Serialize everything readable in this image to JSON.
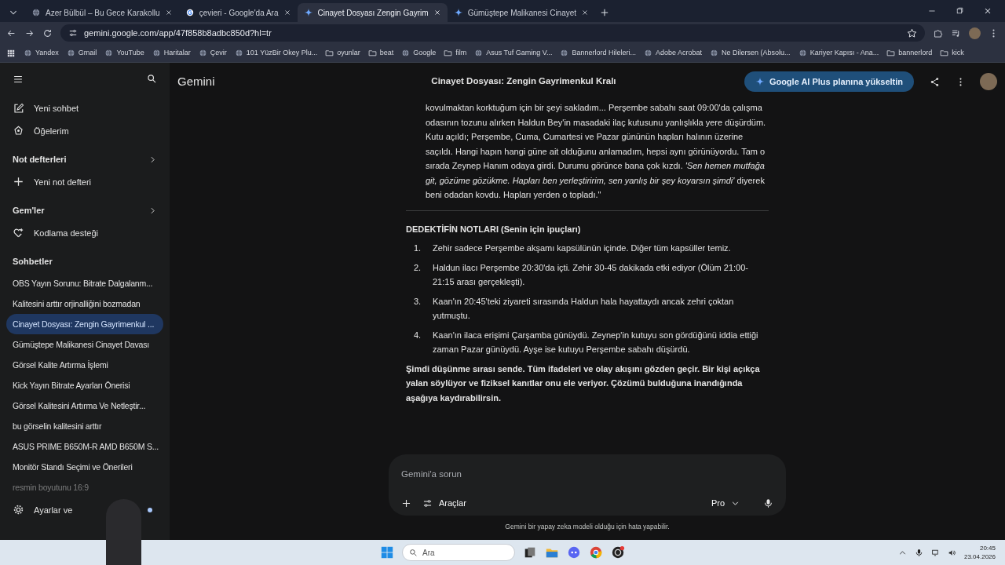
{
  "browser": {
    "tabs": [
      {
        "title": "Azer Bülbül – Bu Gece Karakollu",
        "selected": false
      },
      {
        "title": "çevieri - Google'da Ara",
        "selected": false
      },
      {
        "title": "Cinayet Dosyası Zengin Gayrim",
        "selected": true
      },
      {
        "title": "Gümüştepe Malikanesi Cinayet",
        "selected": false
      }
    ],
    "address": "gemini.google.com/app/47f858b8adbc850d?hl=tr",
    "bookmarks": [
      {
        "label": "Yandex",
        "kind": "site"
      },
      {
        "label": "Gmail",
        "kind": "site"
      },
      {
        "label": "YouTube",
        "kind": "site"
      },
      {
        "label": "Haritalar",
        "kind": "site"
      },
      {
        "label": "Çevir",
        "kind": "site"
      },
      {
        "label": "101 YüzBir Okey Plu...",
        "kind": "site"
      },
      {
        "label": "oyunlar",
        "kind": "folder"
      },
      {
        "label": "beat",
        "kind": "folder"
      },
      {
        "label": "Google",
        "kind": "site"
      },
      {
        "label": "film",
        "kind": "folder"
      },
      {
        "label": "Asus Tuf Gaming V...",
        "kind": "site"
      },
      {
        "label": "Bannerlord Hileleri...",
        "kind": "site"
      },
      {
        "label": "Adobe Acrobat",
        "kind": "site"
      },
      {
        "label": "Ne Dilersen (Absolu...",
        "kind": "site"
      },
      {
        "label": "Kariyer Kapısı - Ana...",
        "kind": "site"
      },
      {
        "label": "bannerlord",
        "kind": "folder"
      },
      {
        "label": "kick",
        "kind": "folder"
      }
    ]
  },
  "sidebar": {
    "top_items": [
      {
        "label": "Yeni sohbet"
      },
      {
        "label": "Öğelerim"
      }
    ],
    "notebooks": {
      "heading": "Not defterleri",
      "items": [
        {
          "label": "Yeni not defteri"
        }
      ]
    },
    "gems": {
      "heading": "Gem'ler",
      "items": [
        {
          "label": "Kodlama desteği"
        }
      ]
    },
    "chats": {
      "heading": "Sohbetler",
      "items": [
        {
          "label": "OBS Yayın Sorunu: Bitrate Dalgalanm...",
          "selected": false
        },
        {
          "label": "Kalitesini arttır orjinalliğini bozmadan",
          "selected": false
        },
        {
          "label": "Cinayet Dosyası: Zengin Gayrimenkul ...",
          "selected": true
        },
        {
          "label": "Gümüştepe Malikanesi Cinayet Davası",
          "selected": false
        },
        {
          "label": "Görsel Kalite Artırma İşlemi",
          "selected": false
        },
        {
          "label": "Kick Yayın Bitrate Ayarları Önerisi",
          "selected": false
        },
        {
          "label": "Görsel Kalitesini Artırma Ve Netleştir...",
          "selected": false
        },
        {
          "label": "bu görselin kalitesini arttır",
          "selected": false
        },
        {
          "label": "ASUS PRIME B650M-R AMD B650M S...",
          "selected": false
        },
        {
          "label": "Monitör Standı Seçimi ve Önerileri",
          "selected": false
        },
        {
          "label": "resmin boyutunu 16:9",
          "selected": false
        }
      ]
    },
    "settings": "Ayarlar ve"
  },
  "header": {
    "app_name": "Gemini",
    "title": "Cinayet Dosyası: Zengin Gayrimenkul Kralı",
    "upgrade": "Google AI Plus planına yükseltin"
  },
  "conversation": {
    "quote": "kovulmaktan korktuğum için bir şeyi sakladım... Perşembe sabahı saat 09:00'da çalışma odasının tozunu alırken Haldun Bey'in masadaki ilaç kutusunu yanlışlıkla yere düşürdüm. Kutu açıldı; Perşembe, Cuma, Cumartesi ve Pazar gününün hapları halının üzerine saçıldı. Hangi hapın hangi güne ait olduğunu anlamadım, hepsi aynı görünüyordu. Tam o sırada Zeynep Hanım odaya girdi. Durumu görünce bana çok kızdı. *'Sen hemen mutfağa git, gözüme gözükme. Hapları ben yerleştiririm, sen yanlış bir şey koyarsın şimdi'* diyerek beni odadan kovdu. Hapları yerden o topladı.\"",
    "notes_heading": "DEDEKTİFİN NOTLARI (Senin için ipuçları)",
    "notes": [
      {
        "number": "1.",
        "text": "Zehir sadece Perşembe akşamı kapsülünün içinde. Diğer tüm kapsüller temiz."
      },
      {
        "number": "2.",
        "text": "Haldun ilacı Perşembe 20:30'da içti. Zehir 30-45 dakikada etki ediyor (Ölüm 21:00-21:15 arası gerçekleşti)."
      },
      {
        "number": "3.",
        "text": "Kaan'ın 20:45'teki ziyareti sırasında Haldun hala hayattaydı ancak zehri çoktan yutmuştu."
      },
      {
        "number": "4.",
        "text": "Kaan'ın ilaca erişimi Çarşamba günüydü. Zeynep'in kutuyu son gördüğünü iddia ettiği zaman Pazar günüydü. Ayşe ise kutuyu Perşembe sabahı düşürdü."
      }
    ],
    "closing": "Şimdi düşünme sırası sende. Tüm ifadeleri ve olay akışını gözden geçir. Bir kişi açıkça yalan söylüyor ve fiziksel kanıtlar onu ele veriyor. Çözümü bulduğuna inandığında aşağıya kaydırabilirsin."
  },
  "composer": {
    "placeholder": "Gemini'a sorun",
    "tools": "Araçlar",
    "model": "Pro"
  },
  "disclaimer": "Gemini bir yapay zeka modeli olduğu için hata yapabilir.",
  "taskbar": {
    "search_placeholder": "Ara",
    "time": "20:45",
    "date": "23.04.2026"
  }
}
